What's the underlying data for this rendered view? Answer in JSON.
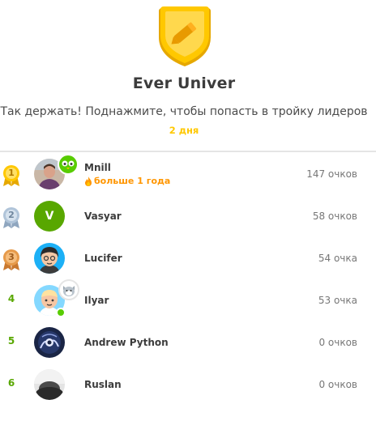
{
  "league": {
    "title": "Ever Univer",
    "subtitle": "Так держать! Поднажмите, чтобы попасть в тройку лидеров",
    "days_left": "2 дня"
  },
  "leaderboard": [
    {
      "rank": "1",
      "name": "Mnill",
      "streak": "больше 1 года",
      "xp": "147 очков"
    },
    {
      "rank": "2",
      "name": "Vasyar",
      "avatar_letter": "V",
      "xp": "58 очков"
    },
    {
      "rank": "3",
      "name": "Lucifer",
      "xp": "54 очка"
    },
    {
      "rank": "4",
      "name": "Ilyar",
      "xp": "53 очка"
    },
    {
      "rank": "5",
      "name": "Andrew Python",
      "xp": "0 очков"
    },
    {
      "rank": "6",
      "name": "Ruslan",
      "xp": "0 очков"
    }
  ],
  "colors": {
    "gold": "#ffc800",
    "silver": "#b0c4d9",
    "bronze": "#e69a4a",
    "rank_green": "#58a700",
    "streak_orange": "#ff9600",
    "online_green": "#58cc02"
  }
}
